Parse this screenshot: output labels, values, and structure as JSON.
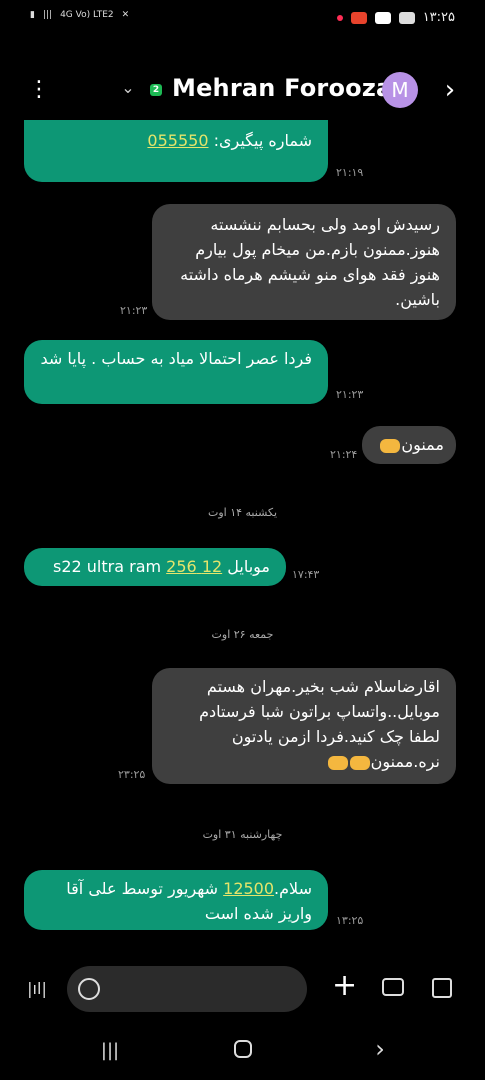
{
  "status_bar": {
    "left_indicators": "4G Vo) LTE2",
    "time": "۱۳:۲۵"
  },
  "header": {
    "contact_name": "Mehran Foroozan",
    "sim_badge": "2",
    "avatar_letter": "M"
  },
  "messages": [
    {
      "dir": "out",
      "parts": [
        {
          "text": "شماره پیگیری: "
        },
        {
          "text": "055550",
          "link": true
        }
      ],
      "time": "۲۱:۱۹"
    },
    {
      "dir": "in",
      "text": "رسیدش اومد ولی بحسابم ننشسته هنوز.ممنون بازم.من میخام پول بیارم هنوز فقد هوای منو شیشم هرماه داشته باشین.",
      "time": "۲۱:۲۳"
    },
    {
      "dir": "out",
      "text": "فردا عصر احتمالا میاد به حساب . پایا شد",
      "time": "۲۱:۲۳"
    },
    {
      "dir": "in",
      "text": "ممنون",
      "emoji_count": 1,
      "time": "۲۱:۲۴"
    },
    {
      "dir": "out",
      "parts": [
        {
          "text": "موبایل "
        },
        {
          "text": "12 256",
          "link": true
        },
        {
          "text": " s22 ultra ram"
        }
      ],
      "time": "۱۷:۴۳"
    },
    {
      "dir": "in",
      "text": "اقارضاسلام شب بخیر.مهران هستم موبایل..واتساپ براتون شبا فرستادم لطفا چک کنید.فردا ازمن یادتون نره.ممنون",
      "emoji_count": 2,
      "time": "۲۳:۲۵"
    },
    {
      "dir": "out",
      "parts": [
        {
          "text": "سلام."
        },
        {
          "text": "12500",
          "link": true
        },
        {
          "text": " شهریور توسط علی آقا واریز شده است"
        }
      ],
      "time": "۱۳:۲۵"
    }
  ],
  "date_separators": [
    "یکشنبه ۱۴ اوت",
    "جمعه ۲۶ اوت",
    "چهارشنبه ۳۱ اوت"
  ],
  "input": {
    "placeholder": ""
  }
}
